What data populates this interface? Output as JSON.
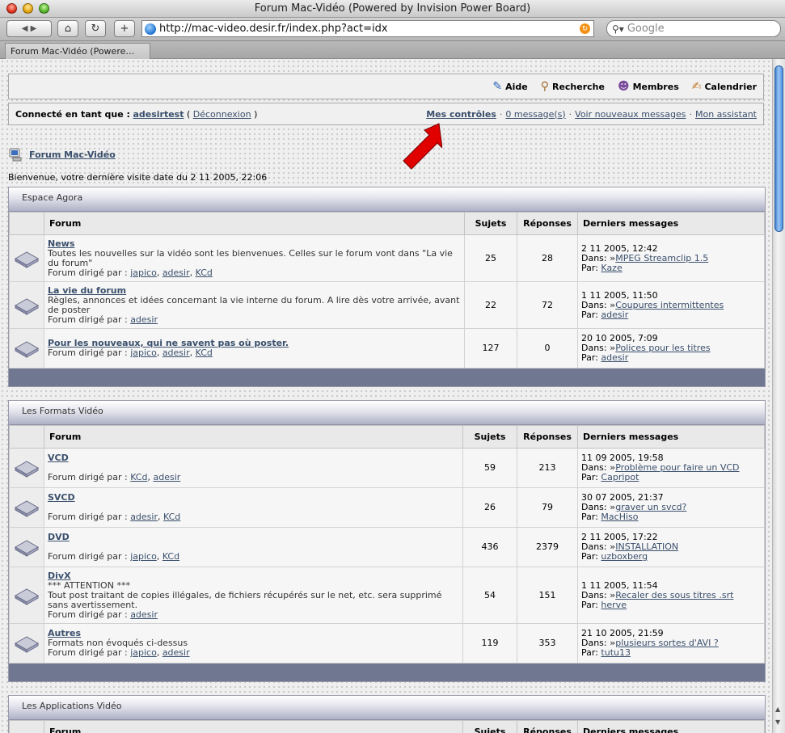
{
  "window": {
    "title": "Forum Mac-Vidéo (Powered by Invision Power Board)"
  },
  "toolbar": {
    "back_label": "◀ ▶",
    "url": "http://mac-video.desir.fr/index.php?act=idx",
    "search_placeholder": "Google"
  },
  "tab": {
    "label": "Forum Mac-Vidéo (Powere…"
  },
  "nav": {
    "aide": "Aide",
    "recherche": "Recherche",
    "membres": "Membres",
    "calendrier": "Calendrier"
  },
  "userbar": {
    "connected_prefix": "Connecté en tant que :",
    "username": "adesirtest",
    "logout": "Déconnexion",
    "mes_controles": "Mes contrôles",
    "messages": "0 message(s)",
    "nouveaux": "Voir nouveaux messages",
    "assistant": "Mon assistant"
  },
  "breadcrumb": {
    "label": "Forum Mac-Vidéo"
  },
  "welcome": "Bienvenue, votre dernière visite date du 2 11 2005, 22:06",
  "columns": {
    "forum": "Forum",
    "sujets": "Sujets",
    "reponses": "Réponses",
    "derniers": "Derniers messages"
  },
  "labels": {
    "mod_prefix": "Forum dirigé par :",
    "dans": "Dans:",
    "par": "Par:"
  },
  "categories": [
    {
      "title": "Espace Agora",
      "forums": [
        {
          "name": "News",
          "desc": "Toutes les nouvelles sur la vidéo sont les bienvenues. Celles sur le forum vont dans \"La vie du forum\"",
          "mods": [
            "japico",
            "adesir",
            "KCd"
          ],
          "sujets": "25",
          "reponses": "28",
          "date": "2 11 2005, 12:42",
          "topic": "MPEG Streamclip 1.5",
          "author": "Kaze"
        },
        {
          "name": "La vie du forum",
          "desc": "Règles, annonces et idées concernant la vie interne du forum. A lire dès votre arrivée, avant de poster",
          "mods": [
            "adesir"
          ],
          "sujets": "22",
          "reponses": "72",
          "date": "1 11 2005, 11:50",
          "topic": "Coupures intermittentes",
          "author": "adesir"
        },
        {
          "name": "Pour les nouveaux, qui ne savent pas où poster.",
          "desc": "",
          "mods": [
            "japico",
            "adesir",
            "KCd"
          ],
          "sujets": "127",
          "reponses": "0",
          "date": "20 10 2005, 7:09",
          "topic": "Polices pour les titres",
          "author": "adesir"
        }
      ]
    },
    {
      "title": "Les Formats Vidéo",
      "forums": [
        {
          "name": "VCD",
          "desc": "",
          "mods": [
            "KCd",
            "adesir"
          ],
          "sujets": "59",
          "reponses": "213",
          "date": "11 09 2005, 19:58",
          "topic": "Problème pour faire un VCD",
          "author": "Capripot"
        },
        {
          "name": "SVCD",
          "desc": "",
          "mods": [
            "adesir",
            "KCd"
          ],
          "sujets": "26",
          "reponses": "79",
          "date": "30 07 2005, 21:37",
          "topic": "graver un svcd?",
          "author": "MacHiso"
        },
        {
          "name": "DVD",
          "desc": "",
          "mods": [
            "japico",
            "KCd"
          ],
          "sujets": "436",
          "reponses": "2379",
          "date": "2 11 2005, 17:22",
          "topic": "INSTALLATION",
          "author": "uzboxberg"
        },
        {
          "name": "DivX",
          "desc": "*** ATTENTION ***\nTout post traitant de copies illégales, de fichiers récupérés sur le net, etc. sera supprimé sans avertissement.",
          "mods": [
            "adesir"
          ],
          "sujets": "54",
          "reponses": "151",
          "date": "1 11 2005, 11:54",
          "topic": "Recaler des sous titres .srt",
          "author": "herve"
        },
        {
          "name": "Autres",
          "desc": "Formats non évoqués ci-dessus",
          "mods": [
            "japico",
            "adesir"
          ],
          "sujets": "119",
          "reponses": "353",
          "date": "21 10 2005, 21:59",
          "topic": "plusieurs sortes d'AVI ?",
          "author": "tutu13"
        }
      ]
    },
    {
      "title": "Les Applications Vidéo",
      "forums": []
    }
  ]
}
